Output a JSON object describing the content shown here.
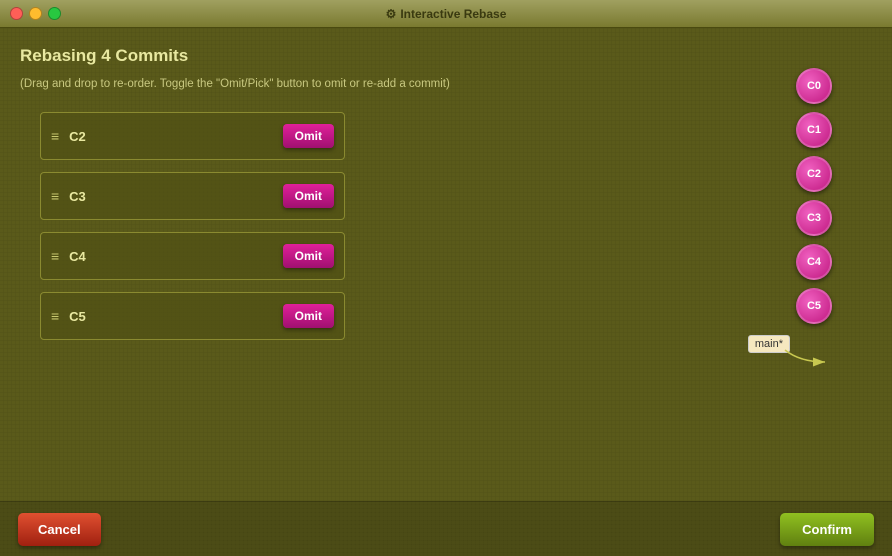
{
  "titleBar": {
    "title": "Interactive Rebase",
    "buttons": {
      "close": "close",
      "minimize": "minimize",
      "maximize": "maximize"
    }
  },
  "heading": "Rebasing 4 Commits",
  "instruction": "(Drag and drop to re-order. Toggle the \"Omit/Pick\" button to omit or re-add a commit)",
  "commits": [
    {
      "id": "C2",
      "omitLabel": "Omit"
    },
    {
      "id": "C3",
      "omitLabel": "Omit"
    },
    {
      "id": "C4",
      "omitLabel": "Omit"
    },
    {
      "id": "C5",
      "omitLabel": "Omit"
    }
  ],
  "circles": [
    {
      "id": "C0"
    },
    {
      "id": "C1"
    },
    {
      "id": "C2"
    },
    {
      "id": "C3"
    },
    {
      "id": "C4"
    },
    {
      "id": "C5"
    }
  ],
  "branchLabel": "main*",
  "buttons": {
    "cancel": "Cancel",
    "confirm": "Confirm"
  }
}
